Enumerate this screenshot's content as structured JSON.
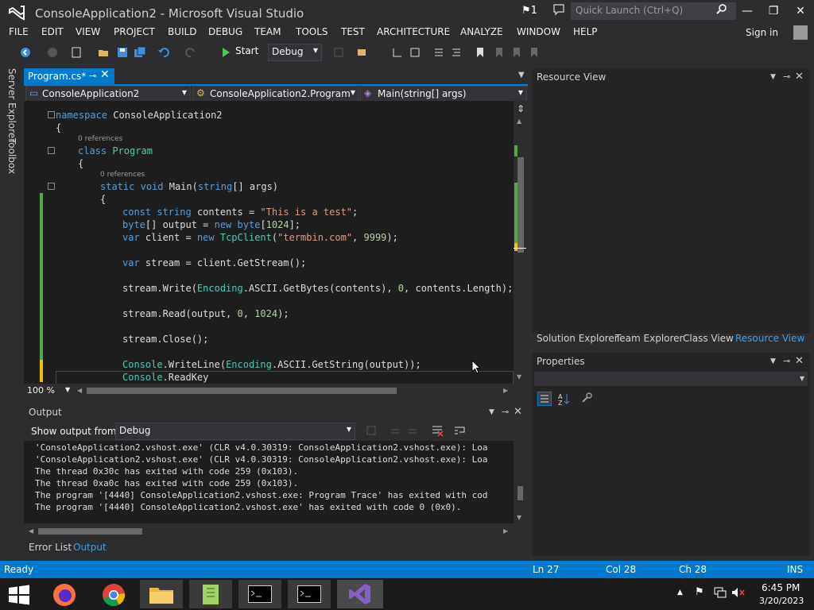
{
  "window": {
    "title": "ConsoleApplication2 - Microsoft Visual Studio",
    "notifications_count": "1",
    "quick_launch_placeholder": "Quick Launch (Ctrl+Q)",
    "sign_in": "Sign in"
  },
  "menu": [
    "FILE",
    "EDIT",
    "VIEW",
    "PROJECT",
    "BUILD",
    "DEBUG",
    "TEAM",
    "TOOLS",
    "TEST",
    "ARCHITECTURE",
    "ANALYZE",
    "WINDOW",
    "HELP"
  ],
  "toolbar": {
    "start_label": "Start",
    "configuration": "Debug"
  },
  "left_strip": [
    "Server Explorer",
    "Toolbox"
  ],
  "document": {
    "tab_label": "Program.cs*",
    "nav_project": "ConsoleApplication2",
    "nav_class": "ConsoleApplication2.Program",
    "nav_member": "Main(string[] args)",
    "zoom": "100 %"
  },
  "code": {
    "ref_label": "0 references",
    "namespace_kw": "namespace",
    "namespace_name": "ConsoleApplication2",
    "open_brace": "{",
    "class_kw": "class",
    "class_name": "Program",
    "static_kw": "static",
    "void_kw": "void",
    "main_sig_a": "Main(",
    "string_kw": "string",
    "main_sig_b": "[] args)",
    "l1_const": "const",
    "l1_string": "string",
    "l1_rest": " contents = ",
    "l1_lit": "\"This is a test\"",
    "l1_end": ";",
    "l2_byte": "byte",
    "l2_mid": "[] output = ",
    "l2_new": "new",
    "l2_byte2": "byte",
    "l2_open": "[",
    "l2_num": "1024",
    "l2_end": "];",
    "l3_var": "var",
    "l3_mid": " client = ",
    "l3_new": "new",
    "l3_type": "TcpClient",
    "l3_open": "(",
    "l3_lit": "\"termbin.com\"",
    "l3_comma": ", ",
    "l3_num": "9999",
    "l3_end": ");",
    "l4_var": "var",
    "l4_rest": " stream = client.GetStream();",
    "l5_a": "stream.Write(",
    "l5_type": "Encoding",
    "l5_b": ".ASCII.GetBytes(contents), ",
    "l5_num": "0",
    "l5_c": ", contents.Length);",
    "l6_a": "stream.Read(output, ",
    "l6_num1": "0",
    "l6_comma": ", ",
    "l6_num2": "1024",
    "l6_end": ");",
    "l7": "stream.Close();",
    "l8_type": "Console",
    "l8_a": ".WriteLine(",
    "l8_type2": "Encoding",
    "l8_b": ".ASCII.GetString(output));",
    "l9_type": "Console",
    "l9_a": ".ReadKey"
  },
  "output": {
    "title": "Output",
    "show_from_label": "Show output from:",
    "source": "Debug",
    "lines": [
      "'ConsoleApplication2.vshost.exe' (CLR v4.0.30319: ConsoleApplication2.vshost.exe): Loa",
      "'ConsoleApplication2.vshost.exe' (CLR v4.0.30319: ConsoleApplication2.vshost.exe): Loa",
      "The thread 0x30c has exited with code 259 (0x103).",
      "The thread 0xa0c has exited with code 259 (0x103).",
      "The program '[4440] ConsoleApplication2.vshost.exe: Program Trace' has exited with cod",
      "The program '[4440] ConsoleApplication2.vshost.exe' has exited with code 0 (0x0)."
    ],
    "tabs": [
      "Error List",
      "Output"
    ]
  },
  "right": {
    "resource_view_title": "Resource View",
    "tabs": [
      "Solution Explorer",
      "Team Explorer",
      "Class View",
      "Resource View"
    ],
    "properties_title": "Properties"
  },
  "status": {
    "state": "Ready",
    "ln": "Ln 27",
    "col": "Col 28",
    "ch": "Ch 28",
    "mode": "INS"
  },
  "clock": {
    "time": "6:45 PM",
    "date": "3/20/2023"
  },
  "colors": {
    "accent": "#007acc",
    "editor_bg": "#1e1e1e",
    "chrome_bg": "#2d2d30"
  }
}
